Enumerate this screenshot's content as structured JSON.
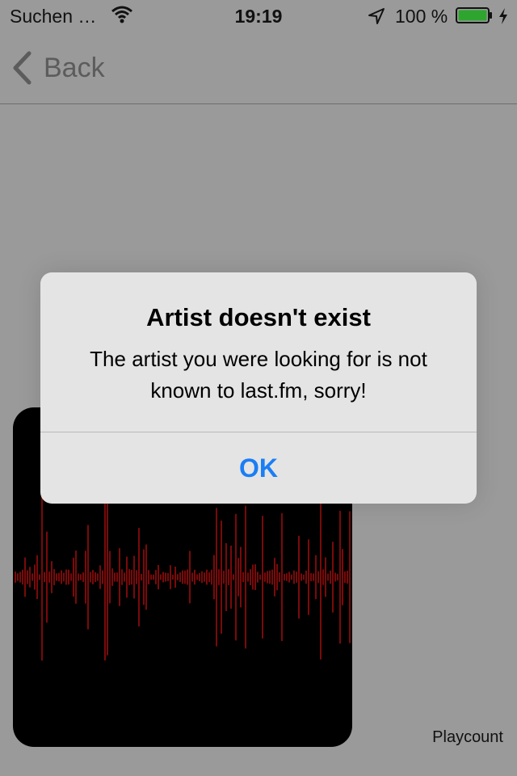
{
  "status_bar": {
    "carrier": "Suchen …",
    "time": "19:19",
    "battery_percent": "100 %",
    "battery_level": 1.0,
    "icons": [
      "wifi-icon",
      "location-arrow-icon",
      "battery-icon",
      "charging-bolt-icon"
    ],
    "battery_color": "#2ea52e"
  },
  "nav": {
    "back_label": "Back"
  },
  "waveform": {
    "bar_color": "#7a0a0a",
    "background": "#000000"
  },
  "playcount_label": "Playcount",
  "alert": {
    "title": "Artist doesn't exist",
    "message_line1": "The artist you were looking for is not",
    "message_line2": "known to last.fm, sorry!",
    "ok_label": "OK",
    "button_color": "#1a7ef5"
  }
}
